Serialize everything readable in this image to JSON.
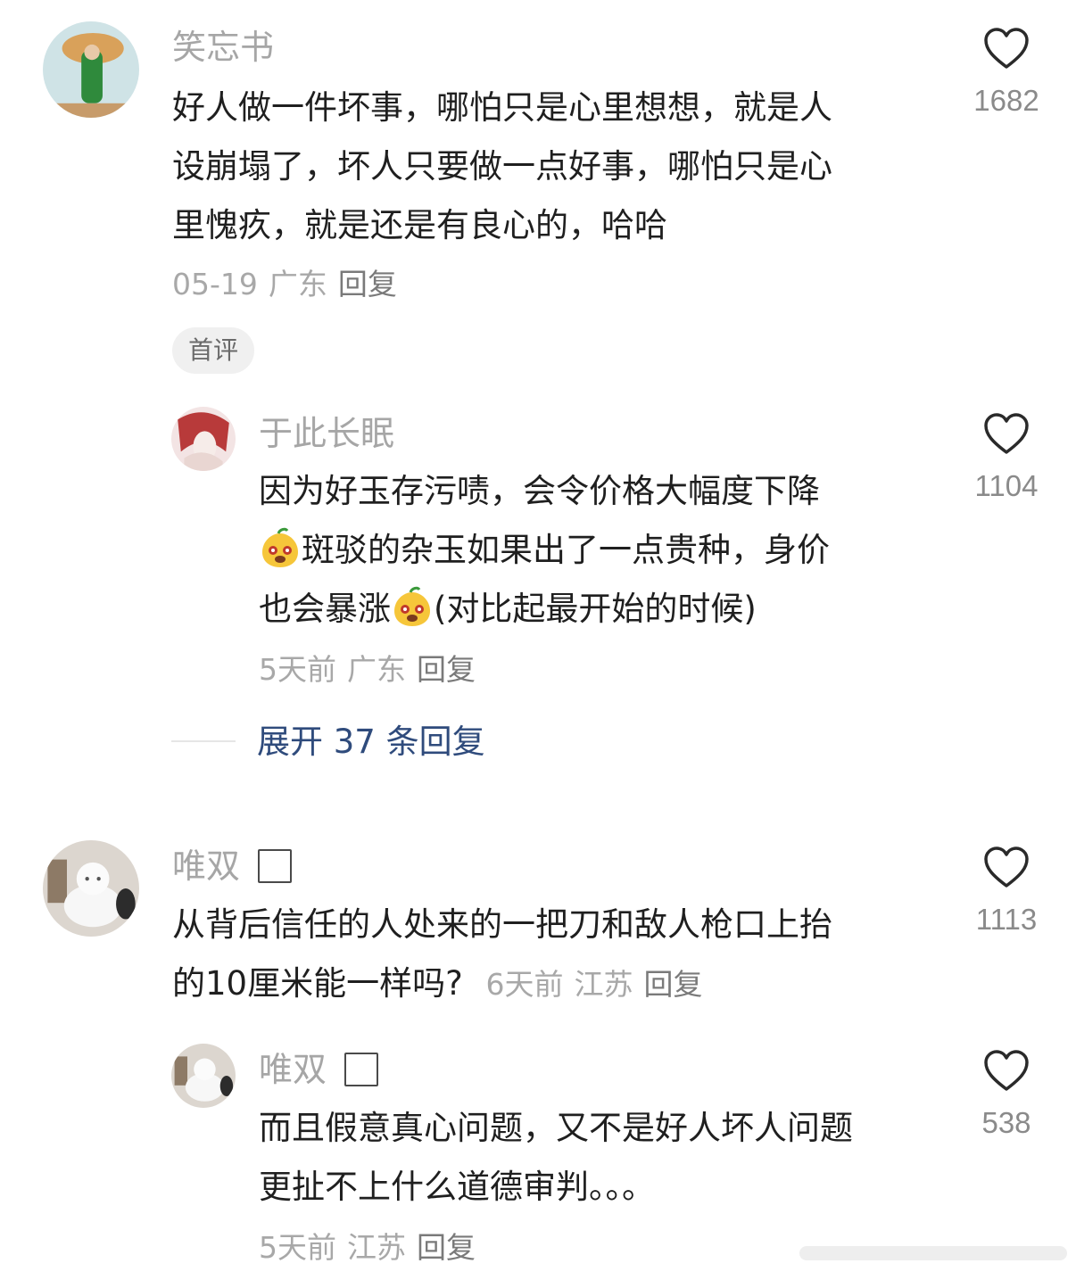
{
  "comments": [
    {
      "username": "笑忘书",
      "lines": [
        "好人做一件坏事，哪怕只是心里想想，就是人",
        "设崩塌了，坏人只要做一点好事，哪怕只是心",
        "里愧疚，就是还是有良心的，哈哈"
      ],
      "time": "05-19",
      "location": "广东",
      "reply_label": "回复",
      "likes": "1682",
      "badge": "首评"
    },
    {
      "username": "于此长眠",
      "line1": "因为好玉存污啧，会令价格大幅度下降",
      "line2": "斑驳的杂玉如果出了一点贵种，身价",
      "line3a": "也会暴涨",
      "line3b": "(对比起最开始的时候)",
      "time": "5天前",
      "location": "广东",
      "reply_label": "回复",
      "likes": "1104"
    },
    {
      "username": "唯双",
      "line1": "从背后信任的人处来的一把刀和敌人枪口上抬",
      "line2": "的10厘米能一样吗?",
      "time": "6天前",
      "location": "江苏",
      "reply_label": "回复",
      "likes": "1113"
    },
    {
      "username": "唯双",
      "lines": [
        "而且假意真心问题，又不是好人坏人问题",
        "更扯不上什么道德审判。。。"
      ],
      "time": "5天前",
      "location": "江苏",
      "reply_label": "回复",
      "likes": "538"
    }
  ],
  "expand_replies": "展开 37 条回复",
  "icons": {
    "like": "heart-outline-icon",
    "emoji": "lemon-face-emoji-icon"
  },
  "colors": {
    "link": "#2f4b7c",
    "muted": "#a8a8a8",
    "text": "#1f1f1f"
  }
}
